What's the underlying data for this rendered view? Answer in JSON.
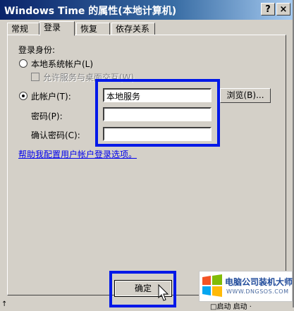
{
  "window": {
    "title": "Windows Time 的属性(本地计算机)",
    "close_label": "×",
    "help_label": "?"
  },
  "tabs": [
    {
      "label": "常规"
    },
    {
      "label": "登录"
    },
    {
      "label": "恢复"
    },
    {
      "label": "依存关系"
    }
  ],
  "logon": {
    "group_label": "登录身份:",
    "local_system": {
      "label": "本地系统帐户(L)",
      "selected": false
    },
    "allow_desktop": {
      "label": "允许服务与桌面交互(W)",
      "checked": false,
      "enabled": false
    },
    "this_account": {
      "label": "此帐户(T):",
      "selected": true,
      "value": "本地服务"
    },
    "browse_label": "浏览(B)...",
    "password": {
      "label": "密码(P):",
      "value": ""
    },
    "confirm_password": {
      "label": "确认密码(C):",
      "value": ""
    },
    "help_link": "帮助我配置用户帐户登录选项。"
  },
  "footer": {
    "ok_label": "确定"
  },
  "watermark": {
    "title": "电脑公司装机大师",
    "subtitle": "WWW.DNGSOS.COM"
  },
  "background_text": {
    "left": "↑",
    "right": "□启动 启动 ·"
  },
  "colors": {
    "highlight": "#0018e8",
    "dialog_face": "#d4d0c8",
    "link": "#0000ee"
  }
}
